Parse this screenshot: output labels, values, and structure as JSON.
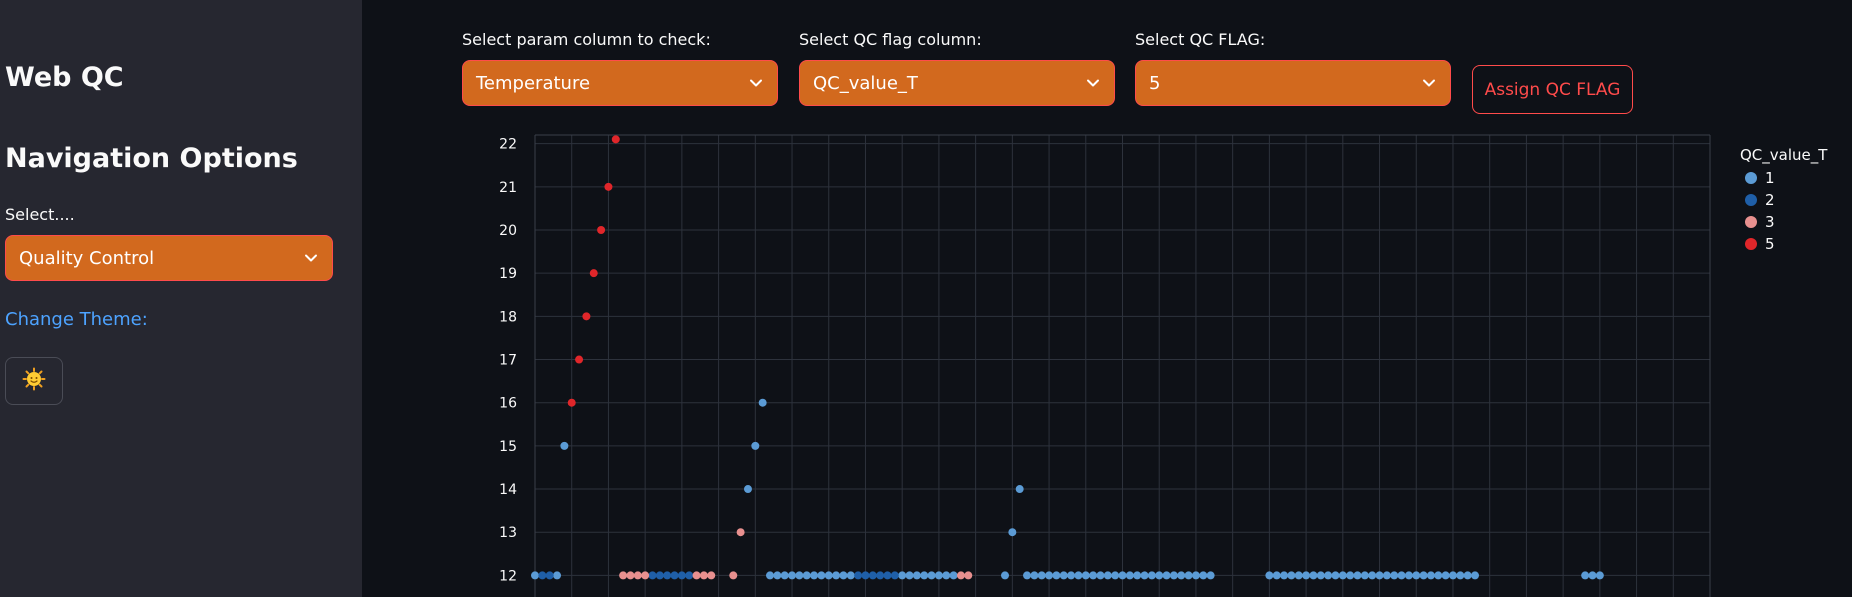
{
  "sidebar": {
    "app_title": "Web QC",
    "nav_heading": "Navigation Options",
    "select_label": "Select....",
    "select_value": "Quality Control",
    "theme_label": "Change Theme:",
    "theme_icon": "sun-face-icon"
  },
  "controls": {
    "param_label": "Select param column to check:",
    "param_value": "Temperature",
    "flag_col_label": "Select QC flag column:",
    "flag_col_value": "QC_value_T",
    "flag_label": "Select QC FLAG:",
    "flag_value": "5",
    "assign_label": "Assign QC FLAG"
  },
  "colors": {
    "accent": "#d2691e",
    "primary": "#ff4b4b",
    "flag_1": "#5b9bd5",
    "flag_2": "#1f5fa8",
    "flag_3": "#e8908f",
    "flag_5": "#e0262a"
  },
  "chart_data": {
    "type": "scatter",
    "legend_title": "QC_value_T",
    "legend_position": "right",
    "grid": true,
    "ylim": [
      11.5,
      22.2
    ],
    "xlim": [
      0,
      160
    ],
    "y_ticks": [
      12,
      13,
      14,
      15,
      16,
      17,
      18,
      19,
      20,
      21,
      22
    ],
    "series": [
      {
        "name": "1",
        "color": "#5b9bd5",
        "points": [
          [
            0,
            12
          ],
          [
            3,
            12
          ],
          [
            4,
            15
          ],
          [
            29,
            14
          ],
          [
            30,
            15
          ],
          [
            31,
            16
          ],
          [
            32,
            12
          ],
          [
            33,
            12
          ],
          [
            34,
            12
          ],
          [
            35,
            12
          ],
          [
            36,
            12
          ],
          [
            37,
            12
          ],
          [
            38,
            12
          ],
          [
            39,
            12
          ],
          [
            40,
            12
          ],
          [
            41,
            12
          ],
          [
            42,
            12
          ],
          [
            43,
            12
          ],
          [
            50,
            12
          ],
          [
            51,
            12
          ],
          [
            52,
            12
          ],
          [
            53,
            12
          ],
          [
            54,
            12
          ],
          [
            55,
            12
          ],
          [
            56,
            12
          ],
          [
            57,
            12
          ],
          [
            64,
            12
          ],
          [
            65,
            13
          ],
          [
            66,
            14
          ],
          [
            67,
            12
          ],
          [
            68,
            12
          ],
          [
            69,
            12
          ],
          [
            70,
            12
          ],
          [
            71,
            12
          ],
          [
            72,
            12
          ],
          [
            73,
            12
          ],
          [
            74,
            12
          ],
          [
            75,
            12
          ],
          [
            76,
            12
          ],
          [
            77,
            12
          ],
          [
            78,
            12
          ],
          [
            79,
            12
          ],
          [
            80,
            12
          ],
          [
            81,
            12
          ],
          [
            82,
            12
          ],
          [
            83,
            12
          ],
          [
            84,
            12
          ],
          [
            85,
            12
          ],
          [
            86,
            12
          ],
          [
            87,
            12
          ],
          [
            88,
            12
          ],
          [
            89,
            12
          ],
          [
            90,
            12
          ],
          [
            91,
            12
          ],
          [
            92,
            12
          ],
          [
            100,
            12
          ],
          [
            101,
            12
          ],
          [
            102,
            12
          ],
          [
            103,
            12
          ],
          [
            104,
            12
          ],
          [
            105,
            12
          ],
          [
            106,
            12
          ],
          [
            107,
            12
          ],
          [
            108,
            12
          ],
          [
            109,
            12
          ],
          [
            110,
            12
          ],
          [
            111,
            12
          ],
          [
            112,
            12
          ],
          [
            113,
            12
          ],
          [
            114,
            12
          ],
          [
            115,
            12
          ],
          [
            116,
            12
          ],
          [
            117,
            12
          ],
          [
            118,
            12
          ],
          [
            119,
            12
          ],
          [
            120,
            12
          ],
          [
            121,
            12
          ],
          [
            122,
            12
          ],
          [
            123,
            12
          ],
          [
            124,
            12
          ],
          [
            125,
            12
          ],
          [
            126,
            12
          ],
          [
            127,
            12
          ],
          [
            128,
            12
          ],
          [
            143,
            12
          ],
          [
            144,
            12
          ],
          [
            145,
            12
          ]
        ]
      },
      {
        "name": "2",
        "color": "#1f5fa8",
        "points": [
          [
            1,
            12
          ],
          [
            2,
            12
          ],
          [
            16,
            12
          ],
          [
            17,
            12
          ],
          [
            18,
            12
          ],
          [
            19,
            12
          ],
          [
            20,
            12
          ],
          [
            21,
            12
          ],
          [
            44,
            12
          ],
          [
            45,
            12
          ],
          [
            46,
            12
          ],
          [
            47,
            12
          ],
          [
            48,
            12
          ],
          [
            49,
            12
          ]
        ]
      },
      {
        "name": "3",
        "color": "#e8908f",
        "points": [
          [
            12,
            12
          ],
          [
            13,
            12
          ],
          [
            14,
            12
          ],
          [
            15,
            12
          ],
          [
            22,
            12
          ],
          [
            23,
            12
          ],
          [
            24,
            12
          ],
          [
            27,
            12
          ],
          [
            28,
            13
          ],
          [
            58,
            12
          ],
          [
            59,
            12
          ]
        ]
      },
      {
        "name": "5",
        "color": "#e0262a",
        "points": [
          [
            5,
            16
          ],
          [
            6,
            17
          ],
          [
            7,
            18
          ],
          [
            8,
            19
          ],
          [
            9,
            20
          ],
          [
            10,
            21
          ],
          [
            11,
            22.1
          ]
        ]
      }
    ]
  }
}
